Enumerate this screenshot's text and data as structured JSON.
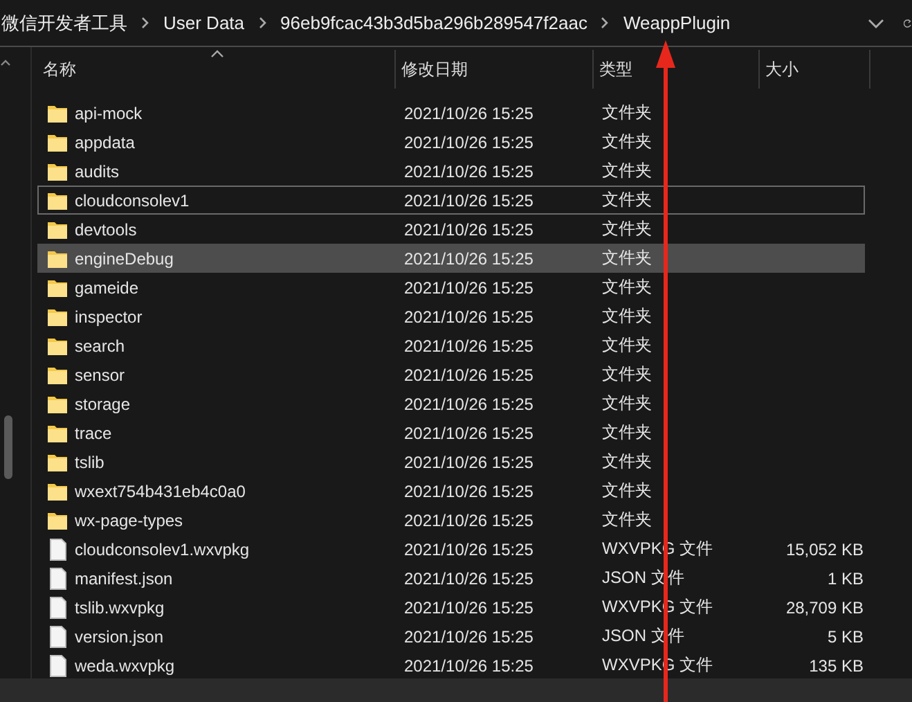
{
  "breadcrumb": [
    {
      "label": "微信开发者工具"
    },
    {
      "label": "User Data"
    },
    {
      "label": "96eb9fcac43b3d5ba296b289547f2aac"
    },
    {
      "label": "WeappPlugin"
    }
  ],
  "columns": [
    {
      "label": "名称",
      "sorted": true
    },
    {
      "label": "修改日期",
      "sorted": false
    },
    {
      "label": "类型",
      "sorted": false
    },
    {
      "label": "大小",
      "sorted": false
    }
  ],
  "rows": [
    {
      "kind": "folder",
      "name": "api-mock",
      "date": "2021/10/26 15:25",
      "type": "文件夹",
      "selected": false,
      "focused": false
    },
    {
      "kind": "folder",
      "name": "appdata",
      "date": "2021/10/26 15:25",
      "type": "文件夹",
      "selected": false,
      "focused": false
    },
    {
      "kind": "folder",
      "name": "audits",
      "date": "2021/10/26 15:25",
      "type": "文件夹",
      "selected": false,
      "focused": false
    },
    {
      "kind": "folder",
      "name": "cloudconsolev1",
      "date": "2021/10/26 15:25",
      "type": "文件夹",
      "selected": false,
      "focused": true
    },
    {
      "kind": "folder",
      "name": "devtools",
      "date": "2021/10/26 15:25",
      "type": "文件夹",
      "selected": false,
      "focused": false
    },
    {
      "kind": "folder",
      "name": "engineDebug",
      "date": "2021/10/26 15:25",
      "type": "文件夹",
      "selected": true,
      "focused": false
    },
    {
      "kind": "folder",
      "name": "gameide",
      "date": "2021/10/26 15:25",
      "type": "文件夹",
      "selected": false,
      "focused": false
    },
    {
      "kind": "folder",
      "name": "inspector",
      "date": "2021/10/26 15:25",
      "type": "文件夹",
      "selected": false,
      "focused": false
    },
    {
      "kind": "folder",
      "name": "search",
      "date": "2021/10/26 15:25",
      "type": "文件夹",
      "selected": false,
      "focused": false
    },
    {
      "kind": "folder",
      "name": "sensor",
      "date": "2021/10/26 15:25",
      "type": "文件夹",
      "selected": false,
      "focused": false
    },
    {
      "kind": "folder",
      "name": "storage",
      "date": "2021/10/26 15:25",
      "type": "文件夹",
      "selected": false,
      "focused": false
    },
    {
      "kind": "folder",
      "name": "trace",
      "date": "2021/10/26 15:25",
      "type": "文件夹",
      "selected": false,
      "focused": false
    },
    {
      "kind": "folder",
      "name": "tslib",
      "date": "2021/10/26 15:25",
      "type": "文件夹",
      "selected": false,
      "focused": false
    },
    {
      "kind": "folder",
      "name": "wxext754b431eb4c0a0",
      "date": "2021/10/26 15:25",
      "type": "文件夹",
      "selected": false,
      "focused": false
    },
    {
      "kind": "folder",
      "name": "wx-page-types",
      "date": "2021/10/26 15:25",
      "type": "文件夹",
      "selected": false,
      "focused": false
    },
    {
      "kind": "file",
      "name": "cloudconsolev1.wxvpkg",
      "date": "2021/10/26 15:25",
      "type": "WXVPKG 文件",
      "size": "15,052 KB",
      "selected": false,
      "focused": false
    },
    {
      "kind": "file",
      "name": "manifest.json",
      "date": "2021/10/26 15:25",
      "type": "JSON 文件",
      "size": "1 KB",
      "selected": false,
      "focused": false
    },
    {
      "kind": "file",
      "name": "tslib.wxvpkg",
      "date": "2021/10/26 15:25",
      "type": "WXVPKG 文件",
      "size": "28,709 KB",
      "selected": false,
      "focused": false
    },
    {
      "kind": "file",
      "name": "version.json",
      "date": "2021/10/26 15:25",
      "type": "JSON 文件",
      "size": "5 KB",
      "selected": false,
      "focused": false
    },
    {
      "kind": "file",
      "name": "weda.wxvpkg",
      "date": "2021/10/26 15:25",
      "type": "WXVPKG 文件",
      "size": "135 KB",
      "selected": false,
      "focused": false
    }
  ]
}
